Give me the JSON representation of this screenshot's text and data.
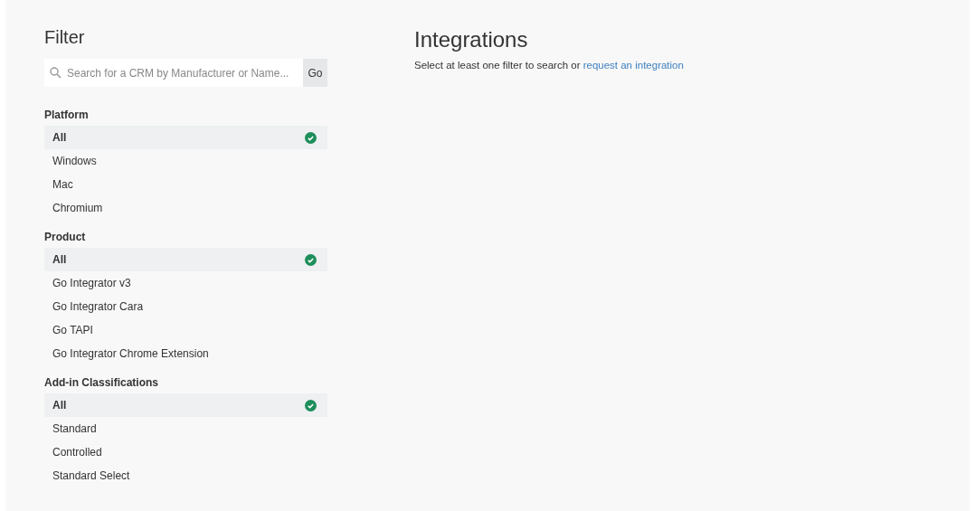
{
  "filter": {
    "title": "Filter",
    "search": {
      "placeholder": "Search for a CRM by Manufacturer or Name...",
      "button": "Go"
    },
    "groups": [
      {
        "heading": "Platform",
        "items": [
          {
            "label": "All",
            "selected": true
          },
          {
            "label": "Windows",
            "selected": false
          },
          {
            "label": "Mac",
            "selected": false
          },
          {
            "label": "Chromium",
            "selected": false
          }
        ]
      },
      {
        "heading": "Product",
        "items": [
          {
            "label": "All",
            "selected": true
          },
          {
            "label": "Go Integrator v3",
            "selected": false
          },
          {
            "label": "Go Integrator Cara",
            "selected": false
          },
          {
            "label": "Go TAPI",
            "selected": false
          },
          {
            "label": "Go Integrator Chrome Extension",
            "selected": false
          }
        ]
      },
      {
        "heading": "Add-in Classifications",
        "items": [
          {
            "label": "All",
            "selected": true
          },
          {
            "label": "Standard",
            "selected": false
          },
          {
            "label": "Controlled",
            "selected": false
          },
          {
            "label": "Standard Select",
            "selected": false
          }
        ]
      }
    ]
  },
  "main": {
    "title": "Integrations",
    "message": "Select at least one filter to search or",
    "link": "request an integration"
  }
}
